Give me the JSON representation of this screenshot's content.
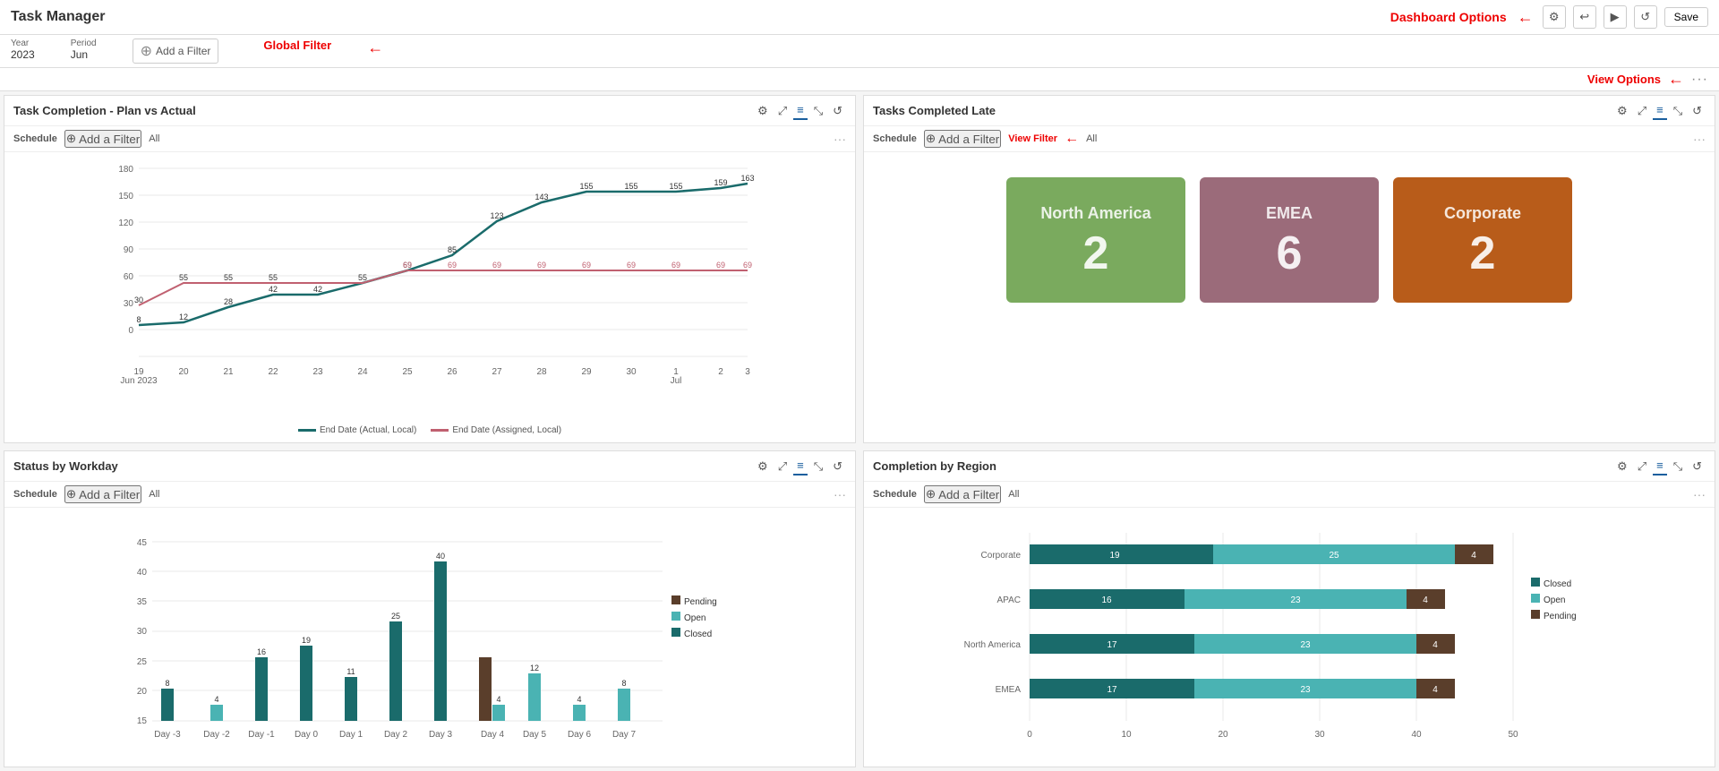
{
  "app": {
    "title": "Task Manager"
  },
  "header": {
    "dashboard_options_label": "Dashboard Options",
    "save_label": "Save",
    "icons": [
      "⚙",
      "↩",
      "▶",
      "↺"
    ]
  },
  "view_options": {
    "label": "View Options",
    "dots": "···"
  },
  "global_filter": {
    "label": "Global Filter",
    "year_label": "Year",
    "year_value": "2023",
    "period_label": "Period",
    "period_value": "Jun",
    "add_filter_label": "Add a Filter"
  },
  "panels": {
    "task_completion": {
      "title": "Task Completion - Plan vs Actual",
      "schedule_label": "Schedule",
      "schedule_value": "All",
      "add_filter": "Add a Filter",
      "legend": [
        {
          "label": "End Date (Actual, Local)",
          "color": "#1a6b6b"
        },
        {
          "label": "End Date (Assigned, Local)",
          "color": "#c06070"
        }
      ],
      "x_labels": [
        "19\nJun 2023",
        "20",
        "21",
        "22",
        "23",
        "24",
        "25",
        "26",
        "27",
        "28",
        "29",
        "30",
        "1\nJul",
        "2",
        "3"
      ],
      "actual_data": [
        8,
        12,
        28,
        42,
        42,
        55,
        69,
        85,
        123,
        143,
        155,
        155,
        155,
        159,
        163
      ],
      "assigned_data": [
        30,
        55,
        55,
        55,
        55,
        55,
        69,
        69,
        69,
        69,
        69,
        69,
        69,
        69,
        69
      ]
    },
    "tasks_late": {
      "title": "Tasks Completed Late",
      "schedule_label": "Schedule",
      "schedule_value": "All",
      "add_filter": "Add a Filter",
      "view_filter_label": "View Filter",
      "regions": [
        {
          "name": "North America",
          "value": "2",
          "css_class": "tile-north-america"
        },
        {
          "name": "EMEA",
          "value": "6",
          "css_class": "tile-emea"
        },
        {
          "name": "Corporate",
          "value": "2",
          "css_class": "tile-corporate"
        }
      ]
    },
    "status_workday": {
      "title": "Status by Workday",
      "schedule_label": "Schedule",
      "schedule_value": "All",
      "add_filter": "Add a Filter",
      "legend": [
        {
          "label": "Pending",
          "color": "#5a3e2b"
        },
        {
          "label": "Open",
          "color": "#4ab3b3"
        },
        {
          "label": "Closed",
          "color": "#1a6b6b"
        }
      ],
      "days": [
        "Day -3",
        "Day -2",
        "Day -1",
        "Day 0",
        "Day 1",
        "Day 2",
        "Day 3",
        "Day 4",
        "Day 5",
        "Day 6",
        "Day 7"
      ],
      "pending": [
        0,
        0,
        0,
        0,
        0,
        0,
        0,
        16,
        0,
        0,
        0
      ],
      "open": [
        0,
        4,
        0,
        0,
        0,
        0,
        0,
        4,
        12,
        4,
        8
      ],
      "closed": [
        8,
        0,
        16,
        19,
        11,
        25,
        40,
        0,
        0,
        0,
        0
      ]
    },
    "completion_region": {
      "title": "Completion by Region",
      "schedule_label": "Schedule",
      "schedule_value": "All",
      "add_filter": "Add a Filter",
      "legend": [
        {
          "label": "Closed",
          "color": "#1a6b6b"
        },
        {
          "label": "Open",
          "color": "#4ab3b3"
        },
        {
          "label": "Pending",
          "color": "#5a3e2b"
        }
      ],
      "regions": [
        "Corporate",
        "APAC",
        "North America",
        "EMEA"
      ],
      "closed": [
        19,
        16,
        17,
        17
      ],
      "open": [
        25,
        23,
        23,
        23
      ],
      "pending": [
        4,
        4,
        4,
        4
      ]
    }
  }
}
